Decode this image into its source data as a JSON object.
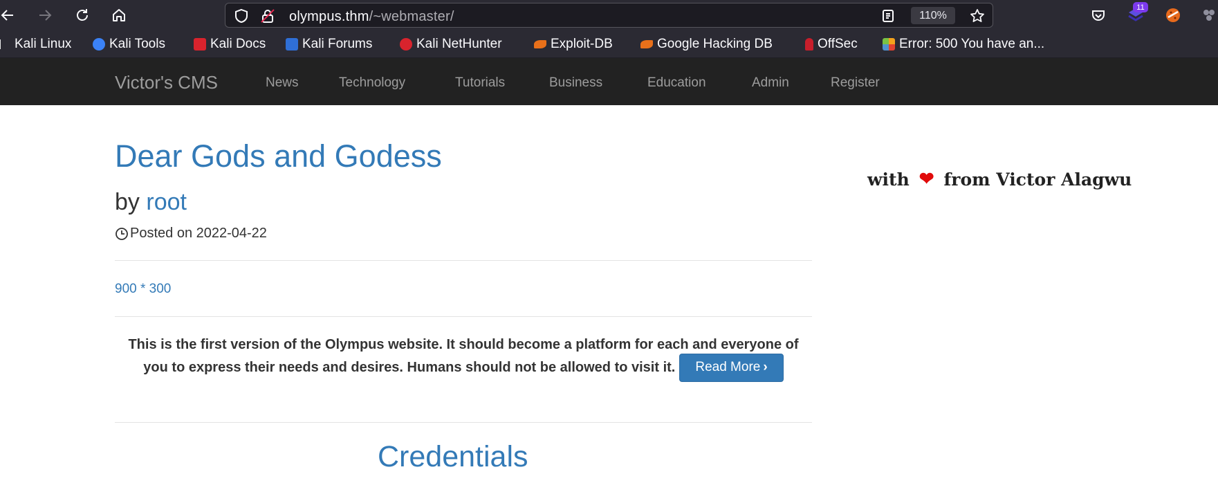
{
  "browser": {
    "url_host": "olympus.thm",
    "url_path": "/~webmaster/",
    "zoom": "110%",
    "extension_badge": "11",
    "bookmarks": [
      {
        "label": "Kali Linux",
        "icon": "kali-icon",
        "color": "#e8e8e8"
      },
      {
        "label": "Kali Tools",
        "icon": "kali-tools-icon",
        "color": "#3b82f6"
      },
      {
        "label": "Kali Docs",
        "icon": "kali-docs-icon",
        "color": "#d9232d"
      },
      {
        "label": "Kali Forums",
        "icon": "kali-forums-icon",
        "color": "#2f6fd6"
      },
      {
        "label": "Kali NetHunter",
        "icon": "nethunter-icon",
        "color": "#d9232d"
      },
      {
        "label": "Exploit-DB",
        "icon": "exploit-db-icon",
        "color": "#e8701a"
      },
      {
        "label": "Google Hacking DB",
        "icon": "ghdb-icon",
        "color": "#e8701a"
      },
      {
        "label": "OffSec",
        "icon": "offsec-icon",
        "color": "#c81e2b"
      },
      {
        "label": "Error: 500 You have an...",
        "icon": "joomla-icon",
        "color": "#f4a21c"
      }
    ]
  },
  "site": {
    "brand": "Victor's CMS",
    "nav": [
      "News",
      "Technology",
      "Tutorials",
      "Business",
      "Education",
      "Admin",
      "Register"
    ]
  },
  "post": {
    "title": "Dear Gods and Godess",
    "by_label": "by",
    "author": "root",
    "posted": "Posted on 2022-04-22",
    "image_alt": "900 * 300",
    "excerpt": "This is the first version of the Olympus website. It should become a platform for each and everyone of you to express their needs and desires. Humans should not be allowed to visit it.",
    "read_more": "Read More"
  },
  "next_post": {
    "title": "Credentials"
  },
  "sidebar": {
    "credit_prefix": "with",
    "credit_suffix": "from Victor Alagwu"
  },
  "colors": {
    "link": "#337ab7",
    "navbar": "#222222",
    "heart": "#e10b0b"
  }
}
